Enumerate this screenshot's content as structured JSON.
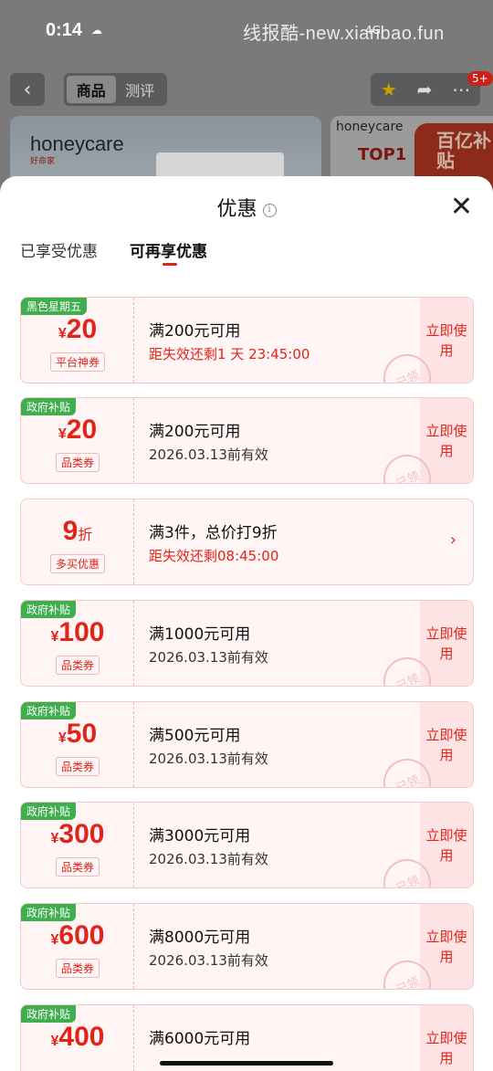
{
  "status": {
    "time": "0:14",
    "watermark": "线报酷-new.xianbao.fun",
    "signal": "4G"
  },
  "topnav": {
    "tabs": [
      "商品",
      "测评"
    ],
    "badge": "5+"
  },
  "banners": {
    "brand1": "honeycare",
    "brand1_sub": "好命家",
    "brand2": "honeycare",
    "top1": "TOP1",
    "subsidy": "百亿补贴"
  },
  "sheet": {
    "title": "优惠",
    "seg_enjoyed": "已享受优惠",
    "seg_more": "可再享优惠"
  },
  "coupons": [
    {
      "tag": "黑色星期五",
      "symbol": "¥",
      "amount": "20",
      "type": "平台神券",
      "condition": "满200元可用",
      "expiry": "距失效还剩1 天 23:45:00",
      "expiry_red": true,
      "action": "立即使用",
      "stamp": "已领"
    },
    {
      "tag": "政府补贴",
      "symbol": "¥",
      "amount": "20",
      "type": "品类券",
      "condition": "满200元可用",
      "expiry": "2026.03.13前有效",
      "expiry_red": false,
      "action": "立即使用",
      "stamp": "已领"
    },
    {
      "tag": "",
      "symbol": "",
      "amount": "9",
      "unit": "折",
      "type": "多买优惠",
      "condition": "满3件，总价打9折",
      "expiry": "距失效还剩08:45:00",
      "expiry_red": true,
      "action": "",
      "arrow": "›"
    },
    {
      "tag": "政府补贴",
      "symbol": "¥",
      "amount": "100",
      "type": "品类券",
      "condition": "满1000元可用",
      "expiry": "2026.03.13前有效",
      "expiry_red": false,
      "action": "立即使用",
      "stamp": "已领"
    },
    {
      "tag": "政府补贴",
      "symbol": "¥",
      "amount": "50",
      "type": "品类券",
      "condition": "满500元可用",
      "expiry": "2026.03.13前有效",
      "expiry_red": false,
      "action": "立即使用",
      "stamp": "已领"
    },
    {
      "tag": "政府补贴",
      "symbol": "¥",
      "amount": "300",
      "type": "品类券",
      "condition": "满3000元可用",
      "expiry": "2026.03.13前有效",
      "expiry_red": false,
      "action": "立即使用",
      "stamp": "已领"
    },
    {
      "tag": "政府补贴",
      "symbol": "¥",
      "amount": "600",
      "type": "品类券",
      "condition": "满8000元可用",
      "expiry": "2026.03.13前有效",
      "expiry_red": false,
      "action": "立即使用",
      "stamp": "已领"
    },
    {
      "tag": "政府补贴",
      "symbol": "¥",
      "amount": "400",
      "type": "",
      "condition": "满6000元可用",
      "expiry": "",
      "expiry_red": false,
      "action": "立即使用",
      "stamp": ""
    }
  ]
}
